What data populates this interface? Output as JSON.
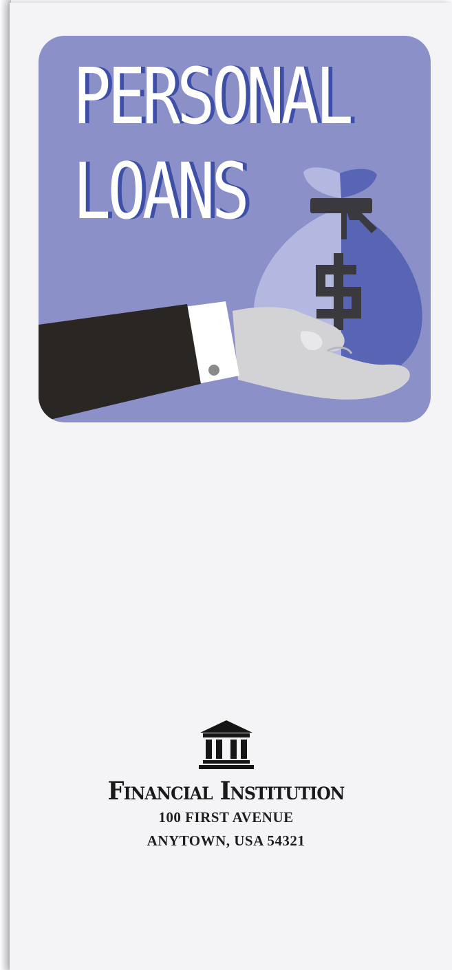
{
  "hero": {
    "title_line1": "PERSONAL",
    "title_line2": "LOANS",
    "bag_symbol": "$"
  },
  "footer": {
    "institution_name": "Financial Institution",
    "address_line1": "100 FIRST AVENUE",
    "address_line2": "ANYTOWN, USA 54321"
  },
  "colors": {
    "hero_background": "#8b90c9",
    "title_shadow": "#3d4fa6",
    "bag_light": "#b4b7e0",
    "bag_dark": "#5865b4",
    "sleeve": "#2a2624",
    "hand": "#d3d3d5",
    "paper": "#f4f4f7"
  },
  "icons": [
    "bank-building-icon",
    "money-bag-icon",
    "dollar-sign-icon"
  ]
}
